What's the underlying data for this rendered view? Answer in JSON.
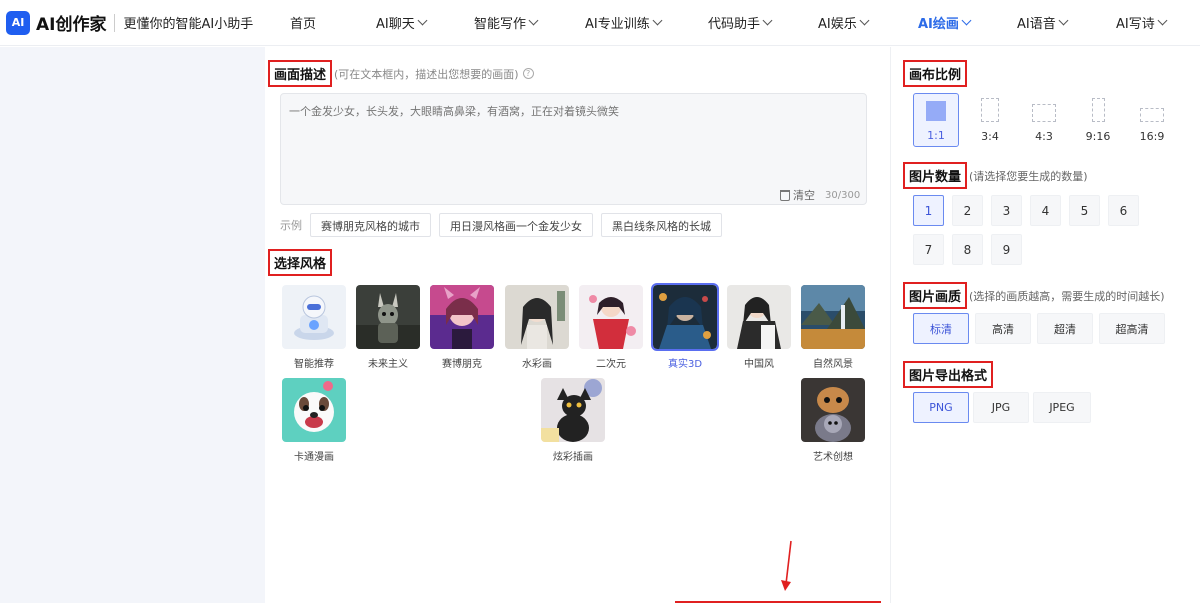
{
  "brand": {
    "logo_text": "AI",
    "title": "AI创作家",
    "slogan": "更懂你的智能AI小助手"
  },
  "nav": [
    {
      "label": "首页",
      "dropdown": false,
      "active": false
    },
    {
      "label": "AI聊天",
      "dropdown": true,
      "active": false
    },
    {
      "label": "智能写作",
      "dropdown": true,
      "active": false
    },
    {
      "label": "AI专业训练",
      "dropdown": true,
      "active": false
    },
    {
      "label": "代码助手",
      "dropdown": true,
      "active": false
    },
    {
      "label": "AI娱乐",
      "dropdown": true,
      "active": false
    },
    {
      "label": "AI绘画",
      "dropdown": true,
      "active": true
    },
    {
      "label": "AI语音",
      "dropdown": true,
      "active": false
    },
    {
      "label": "AI写诗",
      "dropdown": true,
      "active": false
    }
  ],
  "description": {
    "title": "画面描述",
    "hint": "(可在文本框内，描述出您想要的画面)",
    "placeholder": "一个金发少女，长头发，大眼睛高鼻梁，有酒窝，正在对着镜头微笑",
    "clear_label": "清空",
    "counter": "30/300",
    "examples_label": "示例",
    "examples": [
      "赛博朋克风格的城市",
      "用日漫风格画一个金发少女",
      "黑白线条风格的长城"
    ]
  },
  "style": {
    "title": "选择风格",
    "items": [
      {
        "label": "智能推荐",
        "selected": false,
        "theme": "robot"
      },
      {
        "label": "未来主义",
        "selected": false,
        "theme": "futurism"
      },
      {
        "label": "赛博朋克",
        "selected": false,
        "theme": "cyberpunk"
      },
      {
        "label": "水彩画",
        "selected": false,
        "theme": "watercolor"
      },
      {
        "label": "二次元",
        "selected": false,
        "theme": "anime"
      },
      {
        "label": "真实3D",
        "selected": true,
        "theme": "real3d"
      },
      {
        "label": "中国风",
        "selected": false,
        "theme": "chinese"
      },
      {
        "label": "自然风景",
        "selected": false,
        "theme": "landscape"
      },
      {
        "label": "卡通漫画",
        "selected": false,
        "theme": "cartoon"
      },
      {
        "label": "炫彩插画",
        "selected": false,
        "theme": "illustration"
      },
      {
        "label": "艺术创想",
        "selected": false,
        "theme": "art"
      }
    ]
  },
  "canvas_ratio": {
    "title": "画布比例",
    "options": [
      {
        "label": "1:1",
        "selected": true
      },
      {
        "label": "3:4",
        "selected": false
      },
      {
        "label": "4:3",
        "selected": false
      },
      {
        "label": "9:16",
        "selected": false
      },
      {
        "label": "16:9",
        "selected": false
      }
    ]
  },
  "image_count": {
    "title": "图片数量",
    "hint": "(请选择您要生成的数量)",
    "options": [
      "1",
      "2",
      "3",
      "4",
      "5",
      "6",
      "7",
      "8",
      "9"
    ],
    "selected": "1"
  },
  "image_quality": {
    "title": "图片画质",
    "hint": "(选择的画质越高，需要生成的时间越长)",
    "options": [
      "标清",
      "高清",
      "超清",
      "超高清"
    ],
    "selected": "标清"
  },
  "export_format": {
    "title": "图片导出格式",
    "options": [
      "PNG",
      "JPG",
      "JPEG"
    ],
    "selected": "PNG"
  },
  "colors": {
    "accent": "#2c6be8",
    "annotation": "#e02020",
    "selected_bg": "#eef2ff"
  }
}
